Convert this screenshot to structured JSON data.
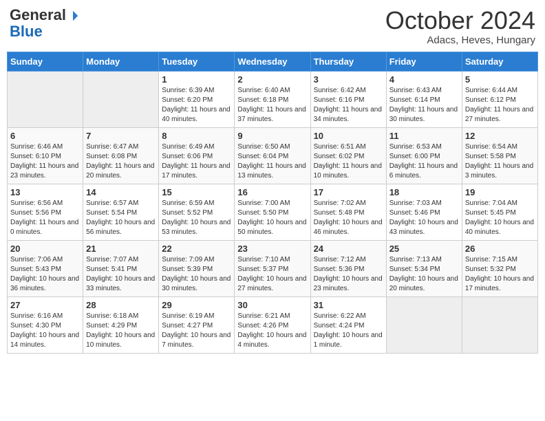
{
  "header": {
    "logo_general": "General",
    "logo_blue": "Blue",
    "month_title": "October 2024",
    "subtitle": "Adacs, Heves, Hungary"
  },
  "days_of_week": [
    "Sunday",
    "Monday",
    "Tuesday",
    "Wednesday",
    "Thursday",
    "Friday",
    "Saturday"
  ],
  "weeks": [
    [
      {
        "day": "",
        "empty": true
      },
      {
        "day": "",
        "empty": true
      },
      {
        "day": "1",
        "sunrise": "Sunrise: 6:39 AM",
        "sunset": "Sunset: 6:20 PM",
        "daylight": "Daylight: 11 hours and 40 minutes."
      },
      {
        "day": "2",
        "sunrise": "Sunrise: 6:40 AM",
        "sunset": "Sunset: 6:18 PM",
        "daylight": "Daylight: 11 hours and 37 minutes."
      },
      {
        "day": "3",
        "sunrise": "Sunrise: 6:42 AM",
        "sunset": "Sunset: 6:16 PM",
        "daylight": "Daylight: 11 hours and 34 minutes."
      },
      {
        "day": "4",
        "sunrise": "Sunrise: 6:43 AM",
        "sunset": "Sunset: 6:14 PM",
        "daylight": "Daylight: 11 hours and 30 minutes."
      },
      {
        "day": "5",
        "sunrise": "Sunrise: 6:44 AM",
        "sunset": "Sunset: 6:12 PM",
        "daylight": "Daylight: 11 hours and 27 minutes."
      }
    ],
    [
      {
        "day": "6",
        "sunrise": "Sunrise: 6:46 AM",
        "sunset": "Sunset: 6:10 PM",
        "daylight": "Daylight: 11 hours and 23 minutes."
      },
      {
        "day": "7",
        "sunrise": "Sunrise: 6:47 AM",
        "sunset": "Sunset: 6:08 PM",
        "daylight": "Daylight: 11 hours and 20 minutes."
      },
      {
        "day": "8",
        "sunrise": "Sunrise: 6:49 AM",
        "sunset": "Sunset: 6:06 PM",
        "daylight": "Daylight: 11 hours and 17 minutes."
      },
      {
        "day": "9",
        "sunrise": "Sunrise: 6:50 AM",
        "sunset": "Sunset: 6:04 PM",
        "daylight": "Daylight: 11 hours and 13 minutes."
      },
      {
        "day": "10",
        "sunrise": "Sunrise: 6:51 AM",
        "sunset": "Sunset: 6:02 PM",
        "daylight": "Daylight: 11 hours and 10 minutes."
      },
      {
        "day": "11",
        "sunrise": "Sunrise: 6:53 AM",
        "sunset": "Sunset: 6:00 PM",
        "daylight": "Daylight: 11 hours and 6 minutes."
      },
      {
        "day": "12",
        "sunrise": "Sunrise: 6:54 AM",
        "sunset": "Sunset: 5:58 PM",
        "daylight": "Daylight: 11 hours and 3 minutes."
      }
    ],
    [
      {
        "day": "13",
        "sunrise": "Sunrise: 6:56 AM",
        "sunset": "Sunset: 5:56 PM",
        "daylight": "Daylight: 11 hours and 0 minutes."
      },
      {
        "day": "14",
        "sunrise": "Sunrise: 6:57 AM",
        "sunset": "Sunset: 5:54 PM",
        "daylight": "Daylight: 10 hours and 56 minutes."
      },
      {
        "day": "15",
        "sunrise": "Sunrise: 6:59 AM",
        "sunset": "Sunset: 5:52 PM",
        "daylight": "Daylight: 10 hours and 53 minutes."
      },
      {
        "day": "16",
        "sunrise": "Sunrise: 7:00 AM",
        "sunset": "Sunset: 5:50 PM",
        "daylight": "Daylight: 10 hours and 50 minutes."
      },
      {
        "day": "17",
        "sunrise": "Sunrise: 7:02 AM",
        "sunset": "Sunset: 5:48 PM",
        "daylight": "Daylight: 10 hours and 46 minutes."
      },
      {
        "day": "18",
        "sunrise": "Sunrise: 7:03 AM",
        "sunset": "Sunset: 5:46 PM",
        "daylight": "Daylight: 10 hours and 43 minutes."
      },
      {
        "day": "19",
        "sunrise": "Sunrise: 7:04 AM",
        "sunset": "Sunset: 5:45 PM",
        "daylight": "Daylight: 10 hours and 40 minutes."
      }
    ],
    [
      {
        "day": "20",
        "sunrise": "Sunrise: 7:06 AM",
        "sunset": "Sunset: 5:43 PM",
        "daylight": "Daylight: 10 hours and 36 minutes."
      },
      {
        "day": "21",
        "sunrise": "Sunrise: 7:07 AM",
        "sunset": "Sunset: 5:41 PM",
        "daylight": "Daylight: 10 hours and 33 minutes."
      },
      {
        "day": "22",
        "sunrise": "Sunrise: 7:09 AM",
        "sunset": "Sunset: 5:39 PM",
        "daylight": "Daylight: 10 hours and 30 minutes."
      },
      {
        "day": "23",
        "sunrise": "Sunrise: 7:10 AM",
        "sunset": "Sunset: 5:37 PM",
        "daylight": "Daylight: 10 hours and 27 minutes."
      },
      {
        "day": "24",
        "sunrise": "Sunrise: 7:12 AM",
        "sunset": "Sunset: 5:36 PM",
        "daylight": "Daylight: 10 hours and 23 minutes."
      },
      {
        "day": "25",
        "sunrise": "Sunrise: 7:13 AM",
        "sunset": "Sunset: 5:34 PM",
        "daylight": "Daylight: 10 hours and 20 minutes."
      },
      {
        "day": "26",
        "sunrise": "Sunrise: 7:15 AM",
        "sunset": "Sunset: 5:32 PM",
        "daylight": "Daylight: 10 hours and 17 minutes."
      }
    ],
    [
      {
        "day": "27",
        "sunrise": "Sunrise: 6:16 AM",
        "sunset": "Sunset: 4:30 PM",
        "daylight": "Daylight: 10 hours and 14 minutes."
      },
      {
        "day": "28",
        "sunrise": "Sunrise: 6:18 AM",
        "sunset": "Sunset: 4:29 PM",
        "daylight": "Daylight: 10 hours and 10 minutes."
      },
      {
        "day": "29",
        "sunrise": "Sunrise: 6:19 AM",
        "sunset": "Sunset: 4:27 PM",
        "daylight": "Daylight: 10 hours and 7 minutes."
      },
      {
        "day": "30",
        "sunrise": "Sunrise: 6:21 AM",
        "sunset": "Sunset: 4:26 PM",
        "daylight": "Daylight: 10 hours and 4 minutes."
      },
      {
        "day": "31",
        "sunrise": "Sunrise: 6:22 AM",
        "sunset": "Sunset: 4:24 PM",
        "daylight": "Daylight: 10 hours and 1 minute."
      },
      {
        "day": "",
        "empty": true
      },
      {
        "day": "",
        "empty": true
      }
    ]
  ]
}
